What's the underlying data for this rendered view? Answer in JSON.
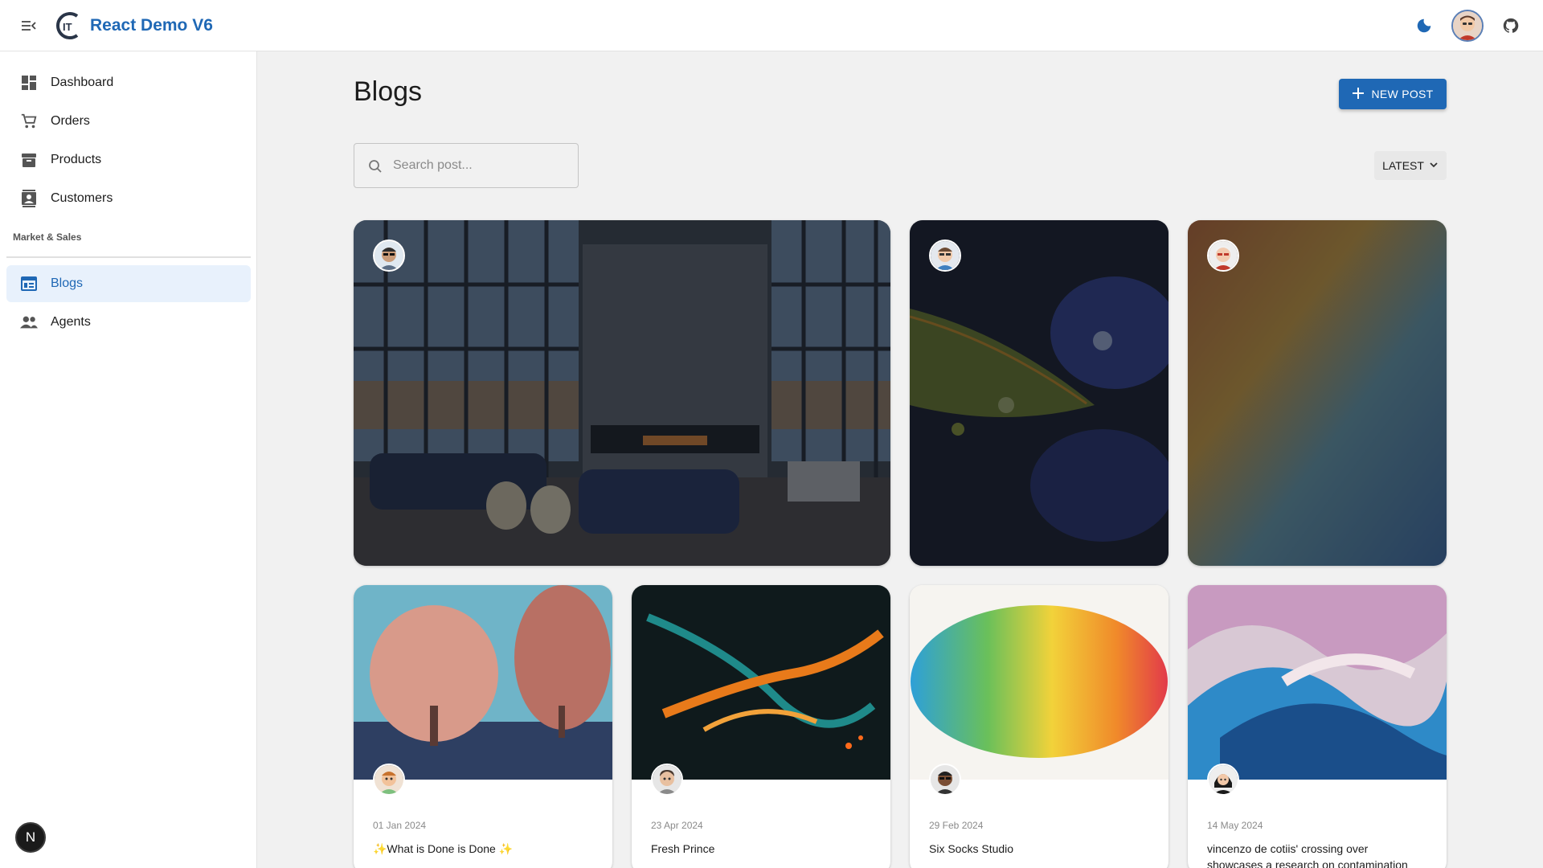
{
  "app": {
    "title": "React Demo V6"
  },
  "header": {
    "icons": [
      "menu-fold-icon",
      "moon-icon",
      "user-avatar",
      "github-icon"
    ]
  },
  "sidebar": {
    "items": [
      {
        "label": "Dashboard",
        "icon": "dashboard-icon"
      },
      {
        "label": "Orders",
        "icon": "cart-icon"
      },
      {
        "label": "Products",
        "icon": "archive-icon"
      },
      {
        "label": "Customers",
        "icon": "contacts-icon"
      }
    ],
    "section_title": "Market & Sales",
    "section_items": [
      {
        "label": "Blogs",
        "icon": "blog-icon",
        "active": true
      },
      {
        "label": "Agents",
        "icon": "people-icon"
      }
    ],
    "bottom_badge": "N"
  },
  "main": {
    "title": "Blogs",
    "new_post_label": "NEW POST",
    "search_placeholder": "Search post...",
    "sort_label": "LATEST"
  },
  "posts": [
    {
      "date": "01 Jan 2024",
      "title": "✨What is Done is Done ✨"
    },
    {
      "date": "23 Apr 2024",
      "title": "Fresh Prince"
    },
    {
      "date": "29 Feb 2024",
      "title": "Six Socks Studio"
    },
    {
      "date": "14 May 2024",
      "title": "vincenzo de cotiis' crossing over showcases a research on contamination"
    }
  ],
  "colors": {
    "accent": "#1f68b5",
    "active_bg": "#e8f1fc"
  }
}
